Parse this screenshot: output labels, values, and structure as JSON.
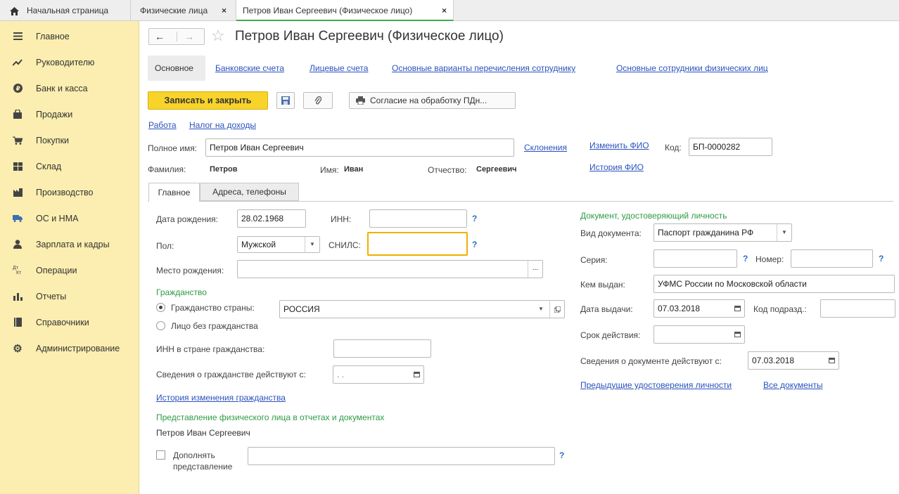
{
  "topbar": {
    "home_label": "Начальная страница",
    "tabs": [
      {
        "label": "Физические лица",
        "close": "×"
      },
      {
        "label": "Петров Иван Сергеевич (Физическое лицо)",
        "close": "×"
      }
    ]
  },
  "sidebar": {
    "items": [
      {
        "label": "Главное",
        "icon": "menu-icon"
      },
      {
        "label": "Руководителю",
        "icon": "trend-icon"
      },
      {
        "label": "Банк и касса",
        "icon": "ruble-icon"
      },
      {
        "label": "Продажи",
        "icon": "bag-icon"
      },
      {
        "label": "Покупки",
        "icon": "cart-icon"
      },
      {
        "label": "Склад",
        "icon": "warehouse-icon"
      },
      {
        "label": "Производство",
        "icon": "factory-icon"
      },
      {
        "label": "ОС и НМА",
        "icon": "truck-icon"
      },
      {
        "label": "Зарплата и кадры",
        "icon": "person-icon"
      },
      {
        "label": "Операции",
        "icon": "dt-kt-icon"
      },
      {
        "label": "Отчеты",
        "icon": "bar-chart-icon"
      },
      {
        "label": "Справочники",
        "icon": "book-icon"
      },
      {
        "label": "Администрирование",
        "icon": "gear-icon"
      }
    ],
    "icons": {
      "dt": "Дт",
      "kt": "Кт"
    }
  },
  "header": {
    "title": "Петров Иван Сергеевич (Физическое лицо)",
    "back": "←",
    "forward": "→",
    "star": "☆"
  },
  "nav_links": {
    "current": "Основное",
    "links": [
      "Банковские счета",
      "Лицевые счета",
      "Основные варианты перечисления сотруднику",
      "Основные сотрудники физических лиц"
    ]
  },
  "toolbar": {
    "save_close": "Записать и закрыть",
    "consent": "Согласие на обработку ПДн...",
    "consent_dots": "..."
  },
  "top_links": {
    "work": "Работа",
    "tax": "Налог на доходы"
  },
  "person": {
    "full_name_label": "Полное имя:",
    "full_name": "Петров Иван Сергеевич",
    "declensions": "Склонения",
    "change_fio": "Изменить ФИО",
    "code_label": "Код:",
    "code": "БП-0000282",
    "surname_label": "Фамилия:",
    "surname": "Петров",
    "name_label": "Имя:",
    "name": "Иван",
    "patronymic_label": "Отчество:",
    "patronymic": "Сергеевич",
    "fio_history": "История ФИО"
  },
  "form_tabs": [
    "Главное",
    "Адреса, телефоны"
  ],
  "main": {
    "birth_date_label": "Дата рождения:",
    "birth_date": "28.02.1968",
    "inn_label": "ИНН:",
    "inn": "",
    "gender_label": "Пол:",
    "gender": "Мужской",
    "snils_label": "СНИЛС:",
    "snils": "",
    "birth_place_label": "Место рождения:",
    "birth_place": "",
    "birth_place_btn": "...",
    "help": "?",
    "citizenship_header": "Гражданство",
    "citizenship_country_label": "Гражданство страны:",
    "citizenship_country": "РОССИЯ",
    "stateless_label": "Лицо без гражданства",
    "inn_foreign_label": "ИНН в стране гражданства:",
    "inn_foreign": "",
    "citizenship_from_label": "Сведения о гражданстве действуют с:",
    "citizenship_from": " .  .",
    "citizenship_history": "История изменения гражданства",
    "representation_header": "Представление физического лица в отчетах и документах",
    "representation_value": "Петров Иван Сергеевич",
    "supplement_label_1": "Дополнять",
    "supplement_label_2": "представление",
    "supplement_value": ""
  },
  "document": {
    "header": "Документ, удостоверяющий личность",
    "type_label": "Вид документа:",
    "type": "Паспорт гражданина РФ",
    "series_label": "Серия:",
    "series": "",
    "number_label": "Номер:",
    "number": "",
    "issued_by_label": "Кем выдан:",
    "issued_by": "УФМС России по Московской области",
    "issue_date_label": "Дата выдачи:",
    "issue_date": "07.03.2018",
    "dept_code_label": "Код подразд.:",
    "dept_code": "",
    "validity_label": "Срок действия:",
    "validity": "",
    "valid_from_label": "Сведения о документе действуют с:",
    "valid_from": "07.03.2018",
    "prev_docs": "Предыдущие удостоверения личности",
    "all_docs": "Все документы"
  },
  "colors": {
    "accent_yellow": "#f8d32a",
    "sidebar_bg": "#fbeeb0",
    "link": "#2a52be",
    "green": "#2e9b45",
    "focus": "#f0b000"
  }
}
